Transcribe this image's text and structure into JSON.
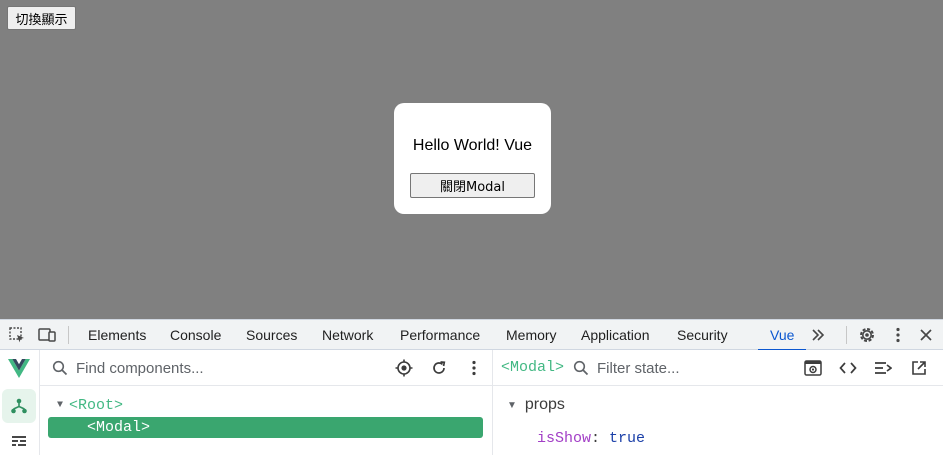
{
  "page": {
    "toggle_button_label": "切換顯示",
    "modal": {
      "text": "Hello World! Vue",
      "close_button_label": "關閉Modal"
    }
  },
  "devtools": {
    "tabs": [
      {
        "label": "Elements"
      },
      {
        "label": "Console"
      },
      {
        "label": "Sources"
      },
      {
        "label": "Network"
      },
      {
        "label": "Performance"
      },
      {
        "label": "Memory"
      },
      {
        "label": "Application"
      },
      {
        "label": "Security"
      },
      {
        "label": "Vue"
      }
    ],
    "active_tab": "Vue",
    "active_color": "#0b57d0"
  },
  "vue": {
    "accent_color": "#42b883",
    "tree_search_placeholder": "Find components...",
    "tree": {
      "root_label": "<Root>",
      "selected_label": "<Modal>"
    },
    "state": {
      "selected_component": "<Modal>",
      "filter_placeholder": "Filter state...",
      "section_title": "props",
      "props": [
        {
          "key": "isShow",
          "value": "true"
        }
      ]
    }
  }
}
